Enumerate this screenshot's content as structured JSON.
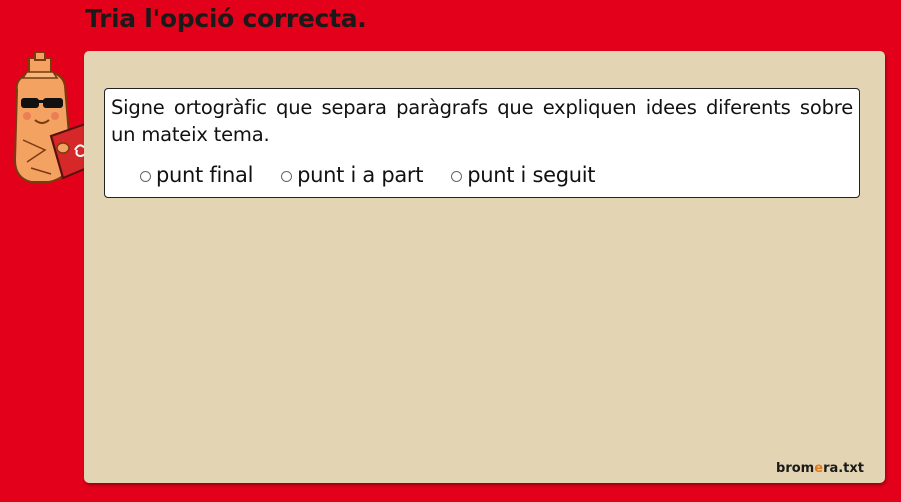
{
  "header": {
    "title": "Tria l'opció correcta."
  },
  "question": {
    "text": "Signe ortogràfic que separa paràgrafs que expliquen idees diferents sobre un mateix tema.",
    "options": [
      {
        "label": "punt final",
        "selected": false
      },
      {
        "label": "punt i a part",
        "selected": false
      },
      {
        "label": "punt i seguit",
        "selected": false
      }
    ]
  },
  "branding": {
    "prefix": "brom",
    "accent": "e",
    "suffix": "ra.txt",
    "accent_color": "#e07a1a"
  },
  "colors": {
    "background": "#e2001a",
    "panel": "#e3d5b3",
    "box": "#ffffff"
  },
  "icons": {
    "mascot": "mascot-with-book-icon"
  }
}
